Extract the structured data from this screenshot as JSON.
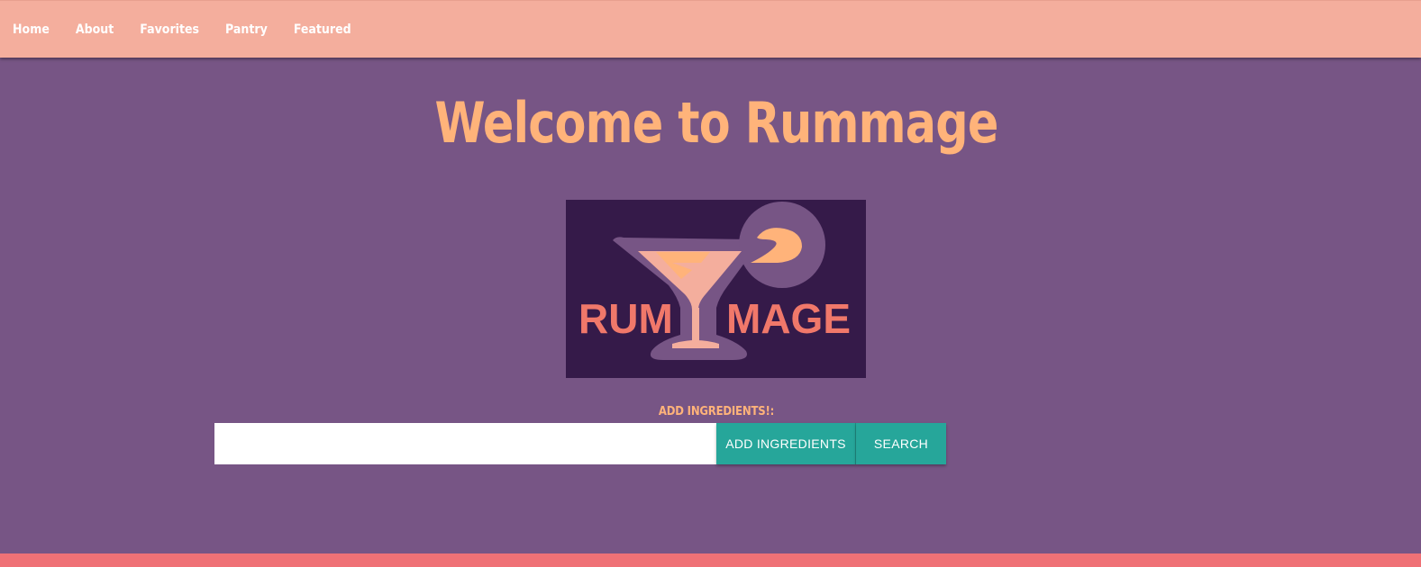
{
  "nav": {
    "items": [
      {
        "label": "Home"
      },
      {
        "label": "About"
      },
      {
        "label": "Favorites"
      },
      {
        "label": "Pantry"
      },
      {
        "label": "Featured"
      }
    ]
  },
  "main": {
    "title": "Welcome to Rummage",
    "logo": {
      "text_left": "RUM",
      "text_right": "MAGE"
    },
    "add_label": "ADD INGREDIENTS!:",
    "ingredient_input": {
      "value": "",
      "placeholder": ""
    },
    "add_button_label": "ADD INGREDIENTS",
    "search_button_label": "SEARCH"
  },
  "colors": {
    "background": "#775585",
    "navbar": "#f4ae9d",
    "accent": "#ffb37a",
    "button": "#26a69a",
    "footer": "#ef7176",
    "logo_background": "#351a49"
  }
}
